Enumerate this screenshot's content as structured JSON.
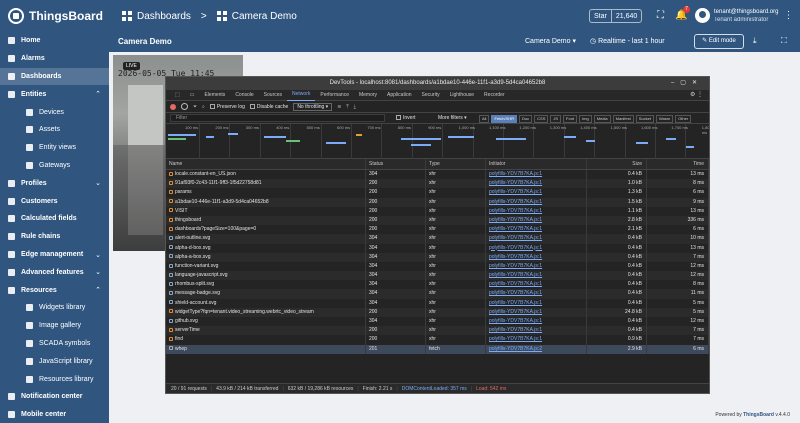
{
  "app": {
    "name": "ThingsBoard"
  },
  "breadcrumbs": [
    {
      "label": "Dashboards"
    },
    {
      "label": "Camera Demo"
    }
  ],
  "github": {
    "star_label": "Star",
    "star_count": "21,640"
  },
  "notifications": {
    "count": "7"
  },
  "user": {
    "email": "tenant@thingsboard.org",
    "role": "Tenant administrator"
  },
  "sidebar": {
    "items": [
      {
        "label": "Home",
        "icon": "home-icon",
        "sub": false
      },
      {
        "label": "Alarms",
        "icon": "alarm-icon",
        "sub": false
      },
      {
        "label": "Dashboards",
        "icon": "dashboards-icon",
        "sub": false,
        "active": true
      },
      {
        "label": "Entities",
        "icon": "entities-icon",
        "sub": false,
        "expanded": true
      },
      {
        "label": "Devices",
        "icon": "devices-icon",
        "sub": true
      },
      {
        "label": "Assets",
        "icon": "assets-icon",
        "sub": true
      },
      {
        "label": "Entity views",
        "icon": "entity-views-icon",
        "sub": true
      },
      {
        "label": "Gateways",
        "icon": "gateways-icon",
        "sub": true
      },
      {
        "label": "Profiles",
        "icon": "profiles-icon",
        "sub": false,
        "collapsed": true
      },
      {
        "label": "Customers",
        "icon": "customers-icon",
        "sub": false
      },
      {
        "label": "Calculated fields",
        "icon": "calculated-fields-icon",
        "sub": false
      },
      {
        "label": "Rule chains",
        "icon": "rule-chains-icon",
        "sub": false
      },
      {
        "label": "Edge management",
        "icon": "edge-icon",
        "sub": false,
        "collapsed": true
      },
      {
        "label": "Advanced features",
        "icon": "advanced-icon",
        "sub": false,
        "collapsed": true
      },
      {
        "label": "Resources",
        "icon": "resources-icon",
        "sub": false,
        "expanded": true
      },
      {
        "label": "Widgets library",
        "icon": "widgets-icon",
        "sub": true
      },
      {
        "label": "Image gallery",
        "icon": "image-gallery-icon",
        "sub": true
      },
      {
        "label": "SCADA symbols",
        "icon": "scada-icon",
        "sub": true
      },
      {
        "label": "JavaScript library",
        "icon": "javascript-icon",
        "sub": true
      },
      {
        "label": "Resources library",
        "icon": "resources-library-icon",
        "sub": true
      },
      {
        "label": "Notification center",
        "icon": "notification-center-icon",
        "sub": false
      },
      {
        "label": "Mobile center",
        "icon": "mobile-center-icon",
        "sub": false
      }
    ]
  },
  "dashboard": {
    "title": "Camera Demo",
    "state": "Camera Demo",
    "timewindow": "Realtime - last 1 hour",
    "edit_label": "Edit mode"
  },
  "camera": {
    "live_label": "LIVE",
    "timestamp": "2026-05-05 Tue 11:45"
  },
  "devtools": {
    "title": "DevTools - localhost:8081/dashboards/a1bdae10-446e-11f1-a3d9-5d4ca04652b8",
    "tabs": [
      "Elements",
      "Console",
      "Sources",
      "Network",
      "Performance",
      "Memory",
      "Application",
      "Security",
      "Lighthouse",
      "Recorder"
    ],
    "active_tab": "Network",
    "toolbar": {
      "preserve_log": "Preserve log",
      "disable_cache": "Disable cache",
      "throttle": "No throttling"
    },
    "filter": {
      "placeholder": "Filter",
      "invert": "Invert",
      "more_filters": "More filters"
    },
    "filter_chips": [
      "All",
      "Fetch/XHR",
      "Doc",
      "CSS",
      "JS",
      "Font",
      "Img",
      "Media",
      "Manifest",
      "Socket",
      "Wasm",
      "Other"
    ],
    "active_chip": "Fetch/XHR",
    "timeline_ticks": [
      "100 ms",
      "200 ms",
      "300 ms",
      "400 ms",
      "500 ms",
      "600 ms",
      "700 ms",
      "800 ms",
      "900 ms",
      "1,000 ms",
      "1,100 ms",
      "1,200 ms",
      "1,300 ms",
      "1,400 ms",
      "1,500 ms",
      "1,600 ms",
      "1,700 ms",
      "1,800 ms"
    ],
    "columns": [
      "Name",
      "Status",
      "Type",
      "Initiator",
      "Size",
      "Time"
    ],
    "requests": [
      {
        "name": "locale.constant-en_US.json",
        "status": "304",
        "type": "xhr",
        "initiator": "polyfills-YDV7B7KA.js:1",
        "size": "0.4 kB",
        "time": "13 ms",
        "kind": "xhr"
      },
      {
        "name": "91af93f0-2c43-11f1-9ff3-1f5d22758d81",
        "status": "200",
        "type": "xhr",
        "initiator": "polyfills-YDV7B7KA.js:1",
        "size": "1.0 kB",
        "time": "8 ms",
        "kind": "xhr"
      },
      {
        "name": "params",
        "status": "200",
        "type": "xhr",
        "initiator": "polyfills-YDV7B7KA.js:1",
        "size": "1.3 kB",
        "time": "6 ms",
        "kind": "xhr"
      },
      {
        "name": "a1bdae10-446e-11f1-a3d9-5d4ca04652b8",
        "status": "200",
        "type": "xhr",
        "initiator": "polyfills-YDV7B7KA.js:1",
        "size": "1.5 kB",
        "time": "9 ms",
        "kind": "xhr"
      },
      {
        "name": "VISIT",
        "status": "200",
        "type": "xhr",
        "initiator": "polyfills-YDV7B7KA.js:1",
        "size": "1.1 kB",
        "time": "13 ms",
        "kind": "xhr"
      },
      {
        "name": "thingsboard",
        "status": "200",
        "type": "xhr",
        "initiator": "polyfills-YDV7B7KA.js:1",
        "size": "2.8 kB",
        "time": "336 ms",
        "kind": "xhr"
      },
      {
        "name": "dashboards?pageSize=100&page=0",
        "status": "200",
        "type": "xhr",
        "initiator": "polyfills-YDV7B7KA.js:1",
        "size": "2.1 kB",
        "time": "6 ms",
        "kind": "xhr"
      },
      {
        "name": "alert-outline.svg",
        "status": "304",
        "type": "xhr",
        "initiator": "polyfills-YDV7B7KA.js:1",
        "size": "0.4 kB",
        "time": "10 ms",
        "kind": "img"
      },
      {
        "name": "alpha-d-box.svg",
        "status": "304",
        "type": "xhr",
        "initiator": "polyfills-YDV7B7KA.js:1",
        "size": "0.4 kB",
        "time": "13 ms",
        "kind": "img"
      },
      {
        "name": "alpha-a-box.svg",
        "status": "304",
        "type": "xhr",
        "initiator": "polyfills-YDV7B7KA.js:1",
        "size": "0.4 kB",
        "time": "7 ms",
        "kind": "img"
      },
      {
        "name": "function-variant.svg",
        "status": "304",
        "type": "xhr",
        "initiator": "polyfills-YDV7B7KA.js:1",
        "size": "0.4 kB",
        "time": "12 ms",
        "kind": "img"
      },
      {
        "name": "language-javascript.svg",
        "status": "304",
        "type": "xhr",
        "initiator": "polyfills-YDV7B7KA.js:1",
        "size": "0.4 kB",
        "time": "12 ms",
        "kind": "img"
      },
      {
        "name": "rhombus-split.svg",
        "status": "304",
        "type": "xhr",
        "initiator": "polyfills-YDV7B7KA.js:1",
        "size": "0.4 kB",
        "time": "8 ms",
        "kind": "img"
      },
      {
        "name": "message-badge.svg",
        "status": "304",
        "type": "xhr",
        "initiator": "polyfills-YDV7B7KA.js:1",
        "size": "0.4 kB",
        "time": "11 ms",
        "kind": "img"
      },
      {
        "name": "shield-account.svg",
        "status": "304",
        "type": "xhr",
        "initiator": "polyfills-YDV7B7KA.js:1",
        "size": "0.4 kB",
        "time": "5 ms",
        "kind": "img"
      },
      {
        "name": "widgetType?fqn=tenant.video_streaming.webrtc_video_stream",
        "status": "200",
        "type": "xhr",
        "initiator": "polyfills-YDV7B7KA.js:1",
        "size": "24.8 kB",
        "time": "5 ms",
        "kind": "xhr"
      },
      {
        "name": "github.svg",
        "status": "304",
        "type": "xhr",
        "initiator": "polyfills-YDV7B7KA.js:1",
        "size": "0.4 kB",
        "time": "12 ms",
        "kind": "img"
      },
      {
        "name": "serverTime",
        "status": "200",
        "type": "xhr",
        "initiator": "polyfills-YDV7B7KA.js:1",
        "size": "0.4 kB",
        "time": "7 ms",
        "kind": "xhr"
      },
      {
        "name": "find",
        "status": "200",
        "type": "xhr",
        "initiator": "polyfills-YDV7B7KA.js:1",
        "size": "0.9 kB",
        "time": "7 ms",
        "kind": "xhr"
      },
      {
        "name": "whep",
        "status": "201",
        "type": "fetch",
        "initiator": "polyfills-YDV7B7KA.js:2",
        "size": "2.9 kB",
        "time": "6 ms",
        "kind": "fetch",
        "selected": true
      }
    ],
    "status_bar": {
      "requests": "20 / 91 requests",
      "transferred": "43.9 kB / 214 kB transferred",
      "resources": "632 kB / 19,286 kB resources",
      "finish": "Finish: 2.21 s",
      "dcl": "DOMContentLoaded: 357 ms",
      "load": "Load: 542 ms"
    }
  },
  "footer": {
    "powered_prefix": "Powered by ",
    "powered_brand": "ThingsBoard",
    "version": " v.4.4.0"
  },
  "colors": {
    "brand": "#305680",
    "devtools_bg": "#242424",
    "link": "#7cacf8",
    "error_red": "#e46962"
  }
}
